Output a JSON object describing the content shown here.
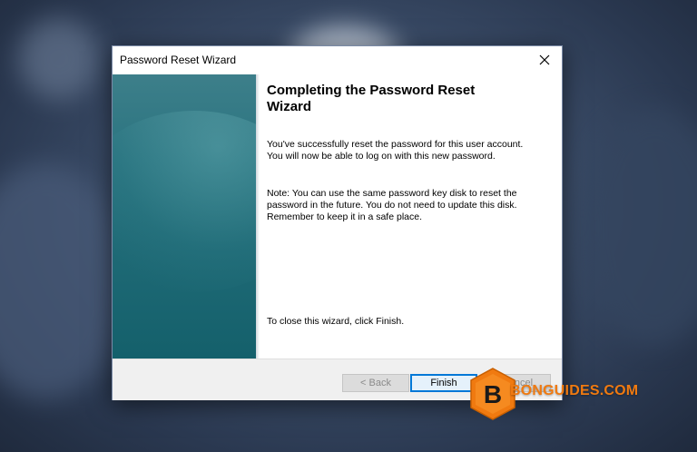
{
  "window": {
    "title": "Password Reset Wizard"
  },
  "content": {
    "heading": "Completing the Password Reset Wizard",
    "paragraph1": "You've successfully reset the password for this user account. You will now be able to log on with this new password.",
    "paragraph2": "Note: You can use the same password key disk to reset the password in the future. You do not need to update this disk. Remember to keep it in a safe place.",
    "paragraph3": "To close this wizard, click Finish."
  },
  "buttons": {
    "back": {
      "label": "< Back",
      "enabled": false
    },
    "finish": {
      "label": "Finish",
      "enabled": true,
      "default": true
    },
    "cancel": {
      "label": "Cancel",
      "enabled": false
    }
  },
  "watermark": {
    "text": "BONGUIDES.COM",
    "logo_letter": "B",
    "color": "#f07a10"
  },
  "colors": {
    "banner": "#1f6a76",
    "accent": "#0078d7"
  },
  "icons": {
    "close": "close-icon"
  }
}
